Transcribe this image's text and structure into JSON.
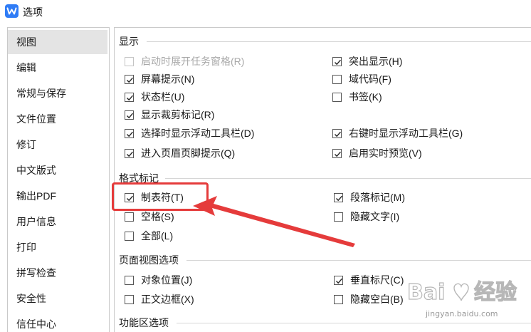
{
  "window": {
    "title": "选项"
  },
  "sidebar": {
    "items": [
      {
        "label": "视图",
        "active": true
      },
      {
        "label": "编辑"
      },
      {
        "label": "常规与保存"
      },
      {
        "label": "文件位置"
      },
      {
        "label": "修订"
      },
      {
        "label": "中文版式"
      },
      {
        "label": "输出PDF"
      },
      {
        "label": "用户信息"
      },
      {
        "label": "打印"
      },
      {
        "label": "拼写检查"
      },
      {
        "label": "安全性"
      },
      {
        "label": "信任中心"
      }
    ]
  },
  "display": {
    "heading": "显示",
    "startup_taskpane": {
      "label": "启动时展开任务窗格(R)",
      "checked": false,
      "disabled": true
    },
    "highlight": {
      "label": "突出显示(H)",
      "checked": true
    },
    "screentips": {
      "label": "屏幕提示(N)",
      "checked": true
    },
    "field_codes": {
      "label": "域代码(F)",
      "checked": false
    },
    "status_bar": {
      "label": "状态栏(U)",
      "checked": true
    },
    "bookmarks": {
      "label": "书签(K)",
      "checked": false
    },
    "crop_marks": {
      "label": "显示裁剪标记(R)",
      "checked": true
    },
    "float_toolbar_select": {
      "label": "选择时显示浮动工具栏(D)",
      "checked": true
    },
    "float_toolbar_rightclick": {
      "label": "右键时显示浮动工具栏(G)",
      "checked": true
    },
    "header_footer_tip": {
      "label": "进入页眉页脚提示(Q)",
      "checked": true
    },
    "live_preview": {
      "label": "启用实时预览(V)",
      "checked": true
    }
  },
  "format_marks": {
    "heading": "格式标记",
    "tab_chars": {
      "label": "制表符(T)",
      "checked": true
    },
    "paragraph_marks": {
      "label": "段落标记(M)",
      "checked": true
    },
    "spaces": {
      "label": "空格(S)",
      "checked": false
    },
    "hidden_text": {
      "label": "隐藏文字(I)",
      "checked": false
    },
    "all": {
      "label": "全部(L)",
      "checked": false
    }
  },
  "page_view": {
    "heading": "页面视图选项",
    "object_position": {
      "label": "对象位置(J)",
      "checked": false
    },
    "vertical_ruler": {
      "label": "垂直标尺(C)",
      "checked": true
    },
    "text_boundaries": {
      "label": "正文边框(X)",
      "checked": false
    },
    "hide_whitespace": {
      "label": "隐藏空白(B)",
      "checked": false
    }
  },
  "ribbon": {
    "heading": "功能区选项"
  },
  "colors": {
    "accent": "#2f7cf6",
    "annotation": "#e53b3b",
    "active_nav": "#e4e4e4"
  },
  "icons": {
    "app": "wps-writer-logo-icon",
    "check": "checkmark-icon"
  },
  "watermark": {
    "brand": "Bai 经验",
    "url": "jingyan.baidu.com"
  }
}
